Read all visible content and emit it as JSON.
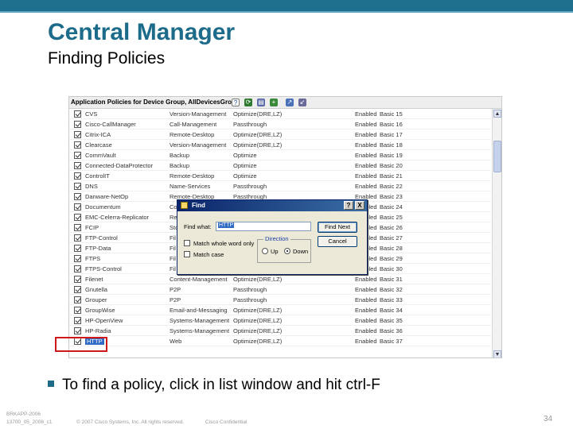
{
  "slide": {
    "title": "Central Manager",
    "subtitle": "Finding Policies",
    "bullet": "To find a policy, click in list window and hit ctrl-F",
    "footer_id_line1": "BRKAPP-2006",
    "footer_id_line2": "13700_05_2008_c1",
    "copyright": "© 2007 Cisco Systems, Inc. All rights reserved.",
    "confidential": "Cisco Confidential",
    "page": "34",
    "colors": {
      "accent": "#1d6b8a",
      "topbar": "#1f6f8f",
      "highlight": "#d01818"
    }
  },
  "app": {
    "header_title": "Application Policies for Device Group, AllDevicesGroup",
    "toolbar_icons": [
      "help-icon",
      "refresh-icon",
      "print-icon",
      "add-icon",
      "export-icon",
      "import-icon"
    ],
    "rows": [
      {
        "name": "CVS",
        "category": "Version-Management",
        "action": "Optimize(DRE,LZ)",
        "state": "Enabled",
        "id": "Basic 15"
      },
      {
        "name": "Cisco-CallManager",
        "category": "Call-Management",
        "action": "Passthrough",
        "state": "Enabled",
        "id": "Basic 16"
      },
      {
        "name": "Citrix-ICA",
        "category": "Remote-Desktop",
        "action": "Optimize(DRE,LZ)",
        "state": "Enabled",
        "id": "Basic 17"
      },
      {
        "name": "Clearcase",
        "category": "Version-Management",
        "action": "Optimize(DRE,LZ)",
        "state": "Enabled",
        "id": "Basic 18"
      },
      {
        "name": "CommVault",
        "category": "Backup",
        "action": "Optimize",
        "state": "Enabled",
        "id": "Basic 19"
      },
      {
        "name": "Connected-DataProtector",
        "category": "Backup",
        "action": "Optimize",
        "state": "Enabled",
        "id": "Basic 20"
      },
      {
        "name": "ControlIT",
        "category": "Remote-Desktop",
        "action": "Optimize",
        "state": "Enabled",
        "id": "Basic 21"
      },
      {
        "name": "DNS",
        "category": "Name-Services",
        "action": "Passthrough",
        "state": "Enabled",
        "id": "Basic 22"
      },
      {
        "name": "Danware-NetOp",
        "category": "Remote-Desktop",
        "action": "Passthrough",
        "state": "Enabled",
        "id": "Basic 23"
      },
      {
        "name": "Documentum",
        "category": "Co",
        "action": "",
        "state": "Enabled",
        "id": "Basic 24"
      },
      {
        "name": "EMC-Celerra-Replicator",
        "category": "Re",
        "action": "",
        "state": "Enabled",
        "id": "Basic 25"
      },
      {
        "name": "FCIP",
        "category": "Sto",
        "action": "",
        "state": "Enabled",
        "id": "Basic 26"
      },
      {
        "name": "FTP-Control",
        "category": "Fil",
        "action": "",
        "state": "Enabled",
        "id": "Basic 27"
      },
      {
        "name": "FTP-Data",
        "category": "Fil",
        "action": "",
        "state": "Enabled",
        "id": "Basic 28"
      },
      {
        "name": "FTPS",
        "category": "Fil",
        "action": "",
        "state": "Enabled",
        "id": "Basic 29"
      },
      {
        "name": "FTPS-Control",
        "category": "Fil",
        "action": "",
        "state": "Enabled",
        "id": "Basic 30"
      },
      {
        "name": "Filenet",
        "category": "Content-Management",
        "action": "Optimize(DRE,LZ)",
        "state": "Enabled",
        "id": "Basic 31"
      },
      {
        "name": "Gnutella",
        "category": "P2P",
        "action": "Passthrough",
        "state": "Enabled",
        "id": "Basic 32"
      },
      {
        "name": "Grouper",
        "category": "P2P",
        "action": "Passthrough",
        "state": "Enabled",
        "id": "Basic 33"
      },
      {
        "name": "GroupWise",
        "category": "Email-and-Messaging",
        "action": "Optimize(DRE,LZ)",
        "state": "Enabled",
        "id": "Basic 34"
      },
      {
        "name": "HP-OpenView",
        "category": "Systems-Management",
        "action": "Optimize(DRE,LZ)",
        "state": "Enabled",
        "id": "Basic 35"
      },
      {
        "name": "HP-Radia",
        "category": "Systems-Management",
        "action": "Optimize(DRE,LZ)",
        "state": "Enabled",
        "id": "Basic 36"
      },
      {
        "name": "HTTP",
        "category": "Web",
        "action": "Optimize(DRE,LZ)",
        "state": "Enabled",
        "id": "Basic 37"
      }
    ],
    "selected_row_index": 22
  },
  "find_dialog": {
    "title": "Find",
    "find_what_label": "Find what:",
    "find_what_value": "HTTP",
    "match_whole_word_label": "Match whole word only",
    "match_case_label": "Match case",
    "direction_label": "Direction",
    "up_label": "Up",
    "down_label": "Down",
    "find_next_label": "Find Next",
    "cancel_label": "Cancel",
    "help_label": "?",
    "close_label": "X"
  }
}
